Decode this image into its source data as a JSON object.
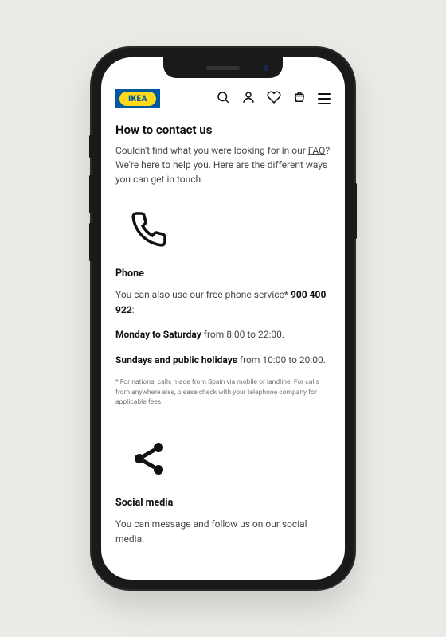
{
  "logo": {
    "text": "IKEA"
  },
  "page": {
    "title": "How to contact us",
    "intro_prefix": "Couldn't find what you were looking for in our ",
    "intro_link": "FAQ",
    "intro_suffix": "? We're here to help you. Here are the different ways you can get in touch."
  },
  "phone": {
    "heading": "Phone",
    "line1_prefix": "You can also use our free phone service* ",
    "line1_number": "900 400 922",
    "line1_suffix": ":",
    "line2_bold": "Monday to Saturday",
    "line2_rest": " from 8:00 to 22:00.",
    "line3_bold": "Sundays and public holidays",
    "line3_rest": " from 10:00 to 20:00.",
    "footnote": "* For national calls made from Spain via mobile or landline. For calls from anywhere else, please check with your telephone company for applicable fees."
  },
  "social": {
    "heading": "Social media",
    "body": "You can message and follow us on our social media."
  }
}
